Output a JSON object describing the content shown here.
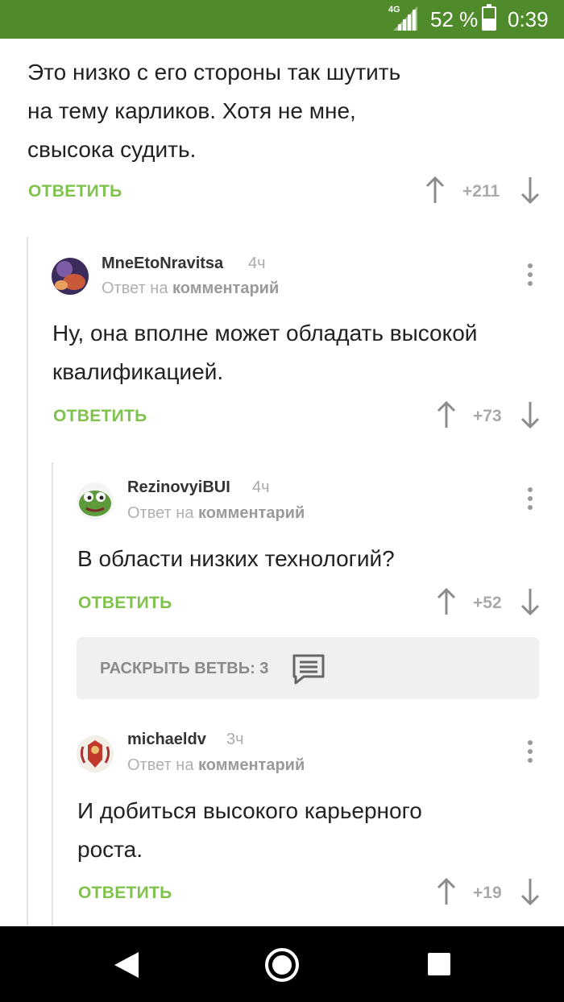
{
  "status": {
    "network": "4G",
    "battery": "52 %",
    "battery_level": 0.52,
    "time": "0:39"
  },
  "top_comment": {
    "text_lines": [
      "Это низко с его стороны так шутить",
      "на тему карликов. Хотя не мне,",
      "свысока судить."
    ],
    "reply_label": "ОТВЕТИТЬ",
    "score": "+211"
  },
  "comments": [
    {
      "author": "MneEtoNravitsa",
      "time": "4ч",
      "reply_prefix": "Ответ на",
      "reply_target": "комментарий",
      "text_lines": [
        "Ну, она вполне может обладать высокой",
        "квалификацией."
      ],
      "reply_label": "ОТВЕТИТЬ",
      "score": "+73",
      "avatar_color": "#3b2c5c"
    },
    {
      "author": "RezinovyiBUI",
      "time": "4ч",
      "reply_prefix": "Ответ на",
      "reply_target": "комментарий",
      "text_lines": [
        "В области низких технологий?"
      ],
      "reply_label": "ОТВЕТИТЬ",
      "score": "+52",
      "avatar_color": "#5c9a3a"
    },
    {
      "author": "michaeldv",
      "time": "3ч",
      "reply_prefix": "Ответ на",
      "reply_target": "комментарий",
      "text_lines": [
        "И добиться высокого карьерного",
        "роста."
      ],
      "reply_label": "ОТВЕТИТЬ",
      "score": "+19",
      "avatar_color": "#c0392b"
    }
  ],
  "expand_branch": {
    "label": "РАСКРЫТЬ ВЕТВЬ: 3"
  },
  "colors": {
    "status_bar": "#4f8a2b",
    "accent": "#7fc34d"
  }
}
